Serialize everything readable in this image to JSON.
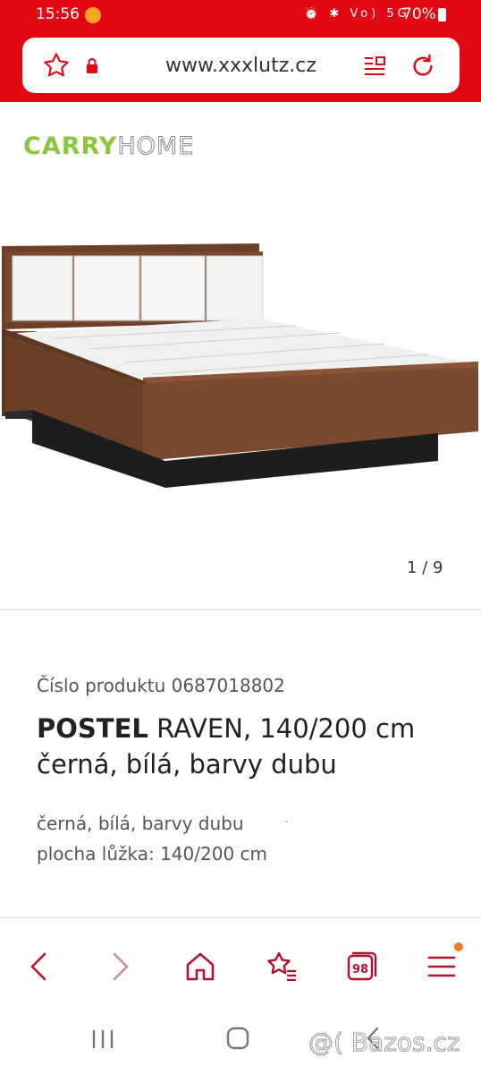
{
  "status_bar": {
    "time": "15:56",
    "status_icons": "⏰ ✱ Vo) 5G",
    "battery": "70%"
  },
  "browser": {
    "url": "www.xxxlutz.cz",
    "bookmark_icon": "star-icon",
    "lock_icon": "lock-icon",
    "reader_icon": "reader-icon",
    "reload_icon": "reload-icon"
  },
  "gallery": {
    "brand_logo_carry": "CARRY",
    "brand_logo_home": "HOME",
    "counter": "1 / 9"
  },
  "product": {
    "number_label": "Číslo produktu 0687018802",
    "title_brand": "POSTEL",
    "title_rest": " RAVEN, 140/200 cm černá, bílá, barvy dubu",
    "attributes": [
      "černá, bílá, barvy dubu",
      "plocha lůžka: 140/200 cm"
    ]
  },
  "bottom_nav": {
    "tabs_count": "98"
  },
  "watermark": "@( Bazos.cz",
  "colors": {
    "brand_red": "#e30613",
    "nav_red": "#b3122e",
    "logo_green": "#8cc63f"
  }
}
